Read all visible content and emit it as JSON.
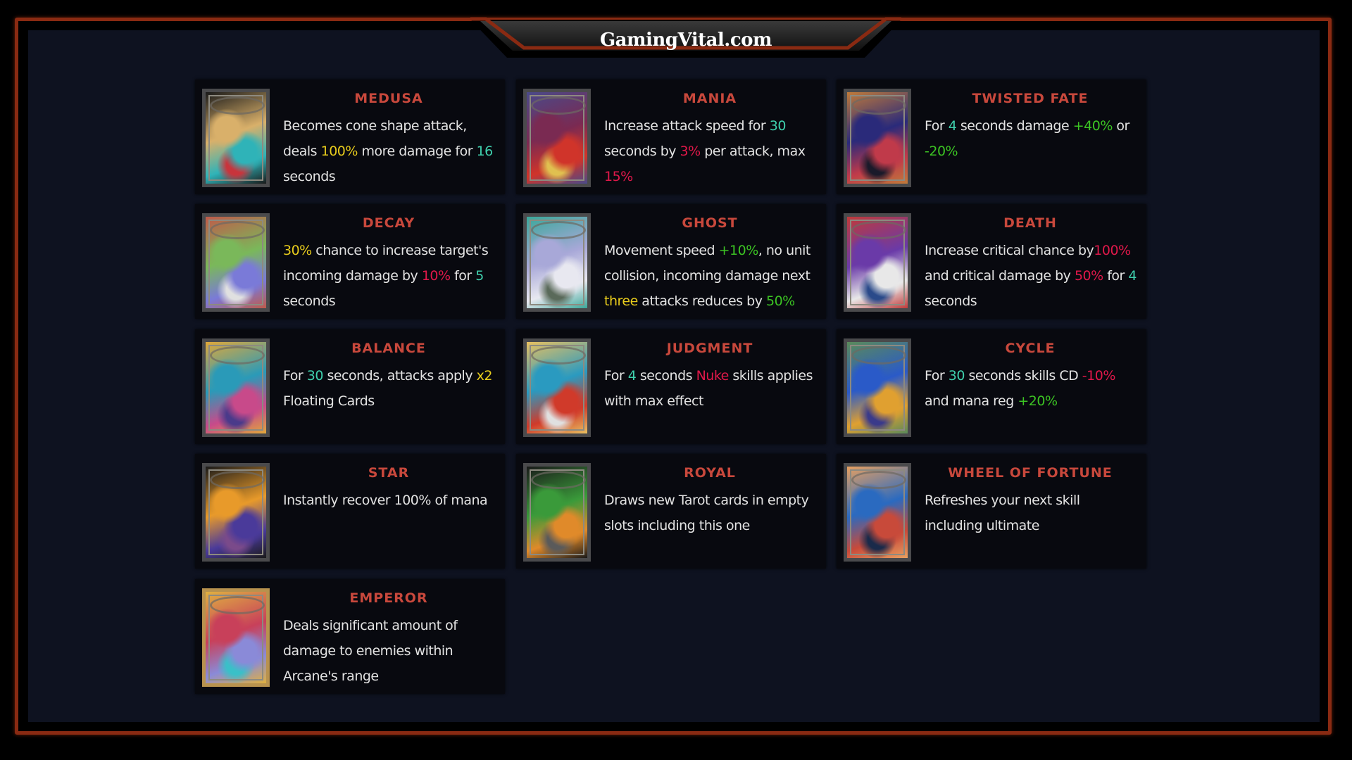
{
  "header": {
    "site_title": "GamingVital.com"
  },
  "theme": {
    "frame_color": "#8a2a12",
    "panel_color": "#0e1220",
    "card_title_color": "#c8483c",
    "highlight_yellow": "#e8cc1c",
    "highlight_teal": "#3fd0ad",
    "highlight_red": "#e0184a",
    "highlight_green": "#3cc423"
  },
  "cards": [
    {
      "title": "MEDUSA",
      "art": [
        "#d9b06a",
        "#2fb3b8",
        "#1a1a1a",
        "#c8343c"
      ],
      "desc": [
        [
          "Becomes cone shape attack, deals ",
          ""
        ],
        [
          "100%",
          "yellow"
        ],
        [
          " more damage for ",
          ""
        ],
        [
          "16",
          "teal"
        ],
        [
          " seconds",
          ""
        ]
      ]
    },
    {
      "title": "MANIA",
      "art": [
        "#7a2a52",
        "#d0342a",
        "#4a4a8a",
        "#e0c050"
      ],
      "desc": [
        [
          "Increase attack speed for ",
          ""
        ],
        [
          "30",
          "teal"
        ],
        [
          " seconds by ",
          ""
        ],
        [
          "3%",
          "red"
        ],
        [
          " per attack, max ",
          ""
        ],
        [
          "15%",
          "red"
        ]
      ]
    },
    {
      "title": "TWISTED FATE",
      "art": [
        "#2a2a7a",
        "#c03a4a",
        "#c07a3a",
        "#1a1a2a"
      ],
      "desc": [
        [
          "For ",
          ""
        ],
        [
          "4",
          "teal"
        ],
        [
          " seconds damage ",
          ""
        ],
        [
          "+40%",
          "green"
        ],
        [
          " or ",
          ""
        ],
        [
          "-20%",
          "green"
        ]
      ]
    },
    {
      "title": "DECAY",
      "art": [
        "#7ab85a",
        "#7a7ad8",
        "#c05a4a",
        "#e0e0e0"
      ],
      "desc": [
        [
          "30%",
          "yellow"
        ],
        [
          " chance to increase target's incoming damage by ",
          ""
        ],
        [
          "10%",
          "red"
        ],
        [
          " for ",
          ""
        ],
        [
          "5",
          "teal"
        ],
        [
          " seconds",
          ""
        ]
      ]
    },
    {
      "title": "GHOST",
      "art": [
        "#a8a8d8",
        "#e8e8f0",
        "#3aa89a",
        "#5a6a5a"
      ],
      "desc": [
        [
          "Movement speed ",
          ""
        ],
        [
          "+10%",
          "green"
        ],
        [
          ", no unit collision, incoming damage next ",
          ""
        ],
        [
          "three",
          "yellow"
        ],
        [
          " attacks reduces by ",
          ""
        ],
        [
          "50%",
          "green"
        ]
      ]
    },
    {
      "title": "DEATH",
      "art": [
        "#6a3aa8",
        "#e8e8e8",
        "#c03a3a",
        "#2a4a8a"
      ],
      "desc": [
        [
          "Increase critical chance by",
          ""
        ],
        [
          "100%",
          "red"
        ],
        [
          " and critical damage by ",
          ""
        ],
        [
          "50%",
          "red"
        ],
        [
          " for ",
          ""
        ],
        [
          "4",
          "teal"
        ],
        [
          " seconds",
          ""
        ]
      ]
    },
    {
      "title": "BALANCE",
      "art": [
        "#2a9ab8",
        "#c84a8a",
        "#e0a83a",
        "#4a3a8a"
      ],
      "desc": [
        [
          "For ",
          ""
        ],
        [
          "30",
          "teal"
        ],
        [
          " seconds, attacks apply ",
          ""
        ],
        [
          "x2",
          "yellow"
        ],
        [
          " Floating Cards",
          ""
        ]
      ]
    },
    {
      "title": "JUDGMENT",
      "art": [
        "#2a9ac0",
        "#d03a2a",
        "#e8c060",
        "#e0e0e0"
      ],
      "desc": [
        [
          "For ",
          ""
        ],
        [
          "4",
          "teal"
        ],
        [
          " seconds ",
          ""
        ],
        [
          "Nuke",
          "red"
        ],
        [
          " skills applies with max effect",
          ""
        ]
      ]
    },
    {
      "title": "CYCLE",
      "art": [
        "#2a5ac8",
        "#e0a030",
        "#5a8a5a",
        "#3a3a8a"
      ],
      "desc": [
        [
          "For ",
          ""
        ],
        [
          "30",
          "teal"
        ],
        [
          " seconds skills CD ",
          ""
        ],
        [
          "-10%",
          "red"
        ],
        [
          " and mana reg ",
          ""
        ],
        [
          "+20%",
          "green"
        ]
      ]
    },
    {
      "title": "STAR",
      "art": [
        "#e89a2a",
        "#4a3a9a",
        "#1a1a1a",
        "#7a4a8a"
      ],
      "desc": [
        [
          "Instantly recover 100% of mana",
          ""
        ]
      ]
    },
    {
      "title": "ROYAL",
      "art": [
        "#3a9a3a",
        "#e08a2a",
        "#1a1a1a",
        "#5a5a5a"
      ],
      "desc": [
        [
          "Draws new Tarot cards in empty slots including this one",
          ""
        ]
      ]
    },
    {
      "title": "WHEEL OF FORTUNE",
      "art": [
        "#2a6ac0",
        "#c84a3a",
        "#e8a060",
        "#1a2a4a"
      ],
      "desc": [
        [
          "Refreshes your next skill including ultimate",
          ""
        ]
      ]
    },
    {
      "title": "EMPEROR",
      "art": [
        "#c8405a",
        "#8a8ad8",
        "#e0b040",
        "#3ac0c8"
      ],
      "gold": true,
      "desc": [
        [
          "Deals significant amount of damage to enemies within Arcane's range",
          ""
        ]
      ]
    }
  ]
}
